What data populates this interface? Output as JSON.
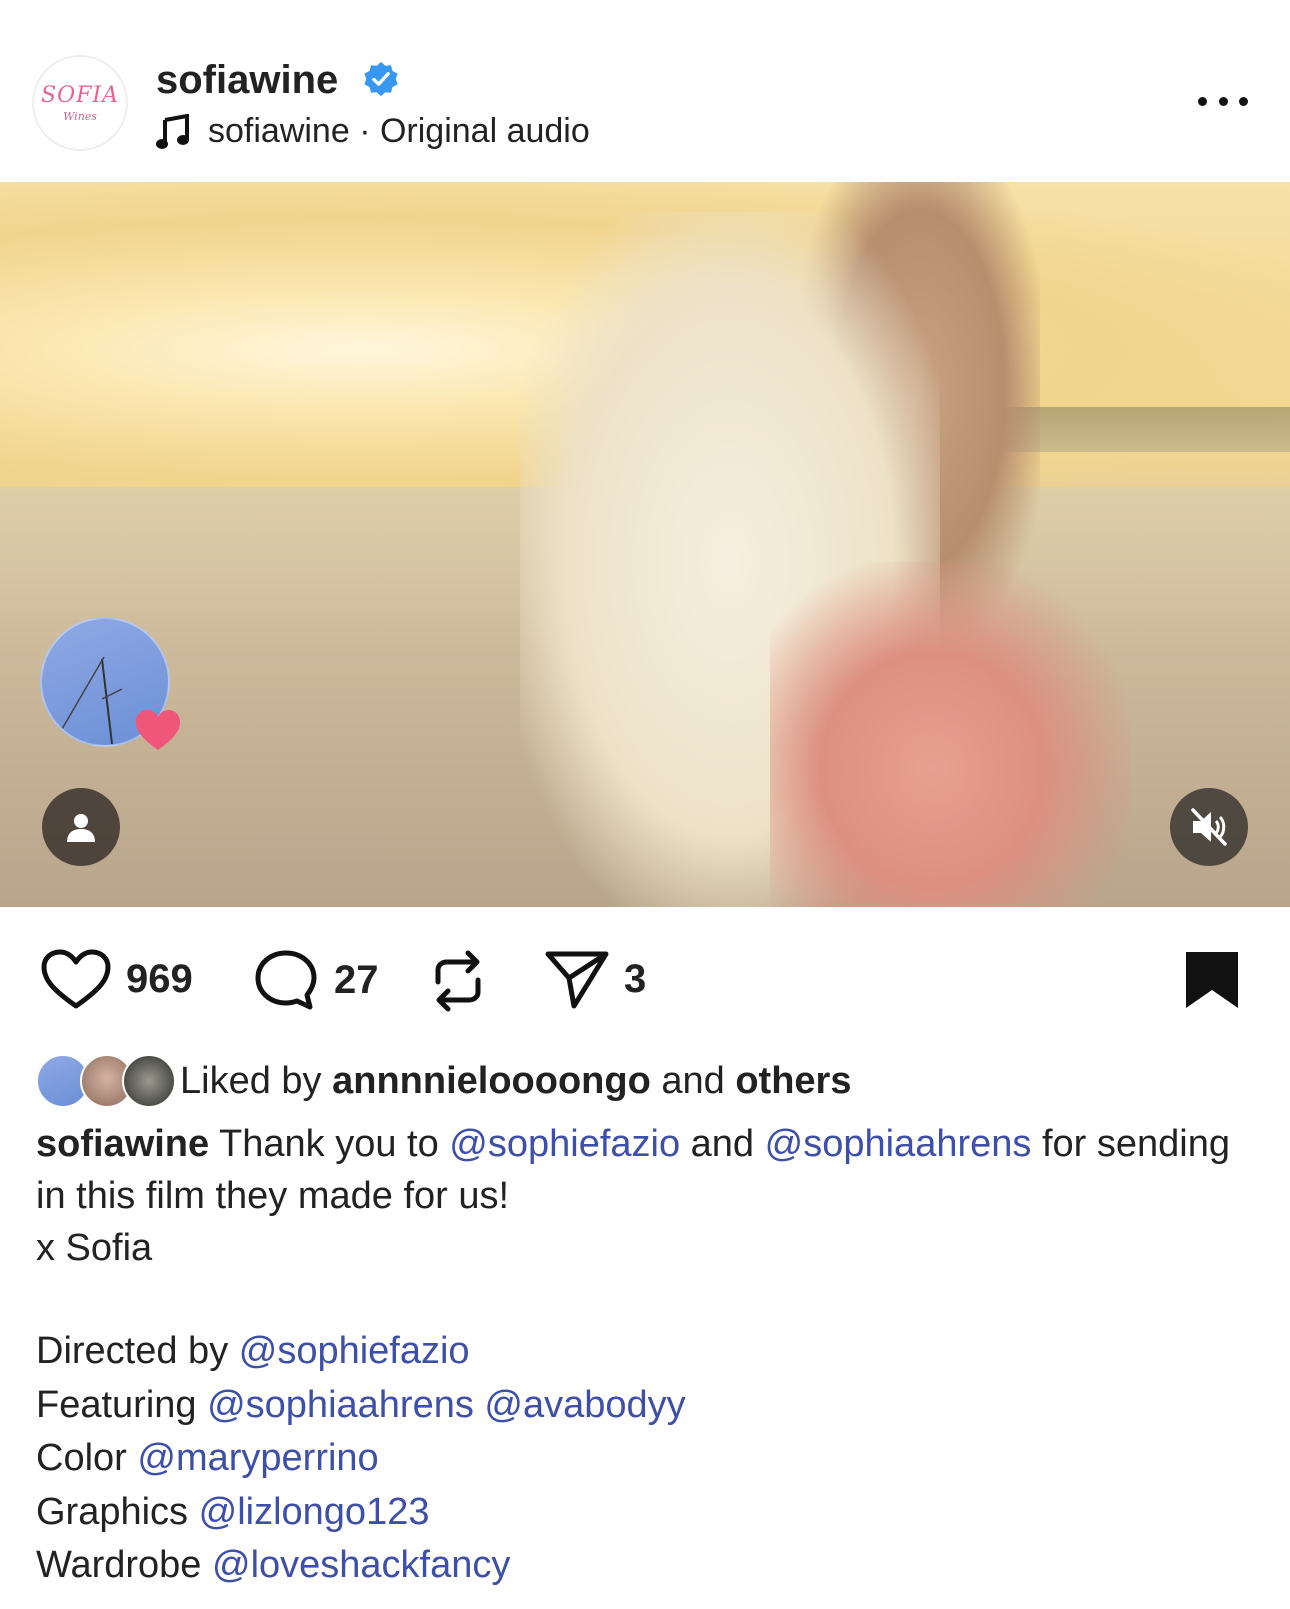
{
  "header": {
    "logo_text": "SOFIA",
    "logo_sub": "Wines",
    "account_name": "sofiawine",
    "audio_owner": "sofiawine",
    "audio_separator": " · ",
    "audio_label": "Original audio"
  },
  "media": {
    "collab_avatar_icon": "antenna-photo",
    "heart_badge_icon": "pink-heart-icon",
    "user_tag_icon": "person-icon",
    "mute_icon": "speaker-muted-icon"
  },
  "actions": {
    "likes": "969",
    "comments": "27",
    "shares": "3"
  },
  "liked_by": {
    "prefix": "Liked by ",
    "user": "annnnieloooongo",
    "and": " and ",
    "others": "others"
  },
  "caption": {
    "user": "sofiawine",
    "text_1": " Thank you to ",
    "mention_1": "@sophiefazio",
    "text_2": " and ",
    "mention_2": "@sophiaahrens",
    "text_3": " for sending in this film they made for us!",
    "sign_off": "x Sofia"
  },
  "credits": [
    {
      "label": "Directed by ",
      "mentions": "@sophiefazio"
    },
    {
      "label": "Featuring ",
      "mentions": "@sophiaahrens @avabodyy"
    },
    {
      "label": "Color ",
      "mentions": "@maryperrino"
    },
    {
      "label": "Graphics ",
      "mentions": "@lizlongo123"
    },
    {
      "label": "Wardrobe ",
      "mentions": "@loveshackfancy"
    }
  ],
  "colors": {
    "mention": "#3d4fa8",
    "verified": "#3897f0",
    "heart_badge": "#f0557a"
  }
}
